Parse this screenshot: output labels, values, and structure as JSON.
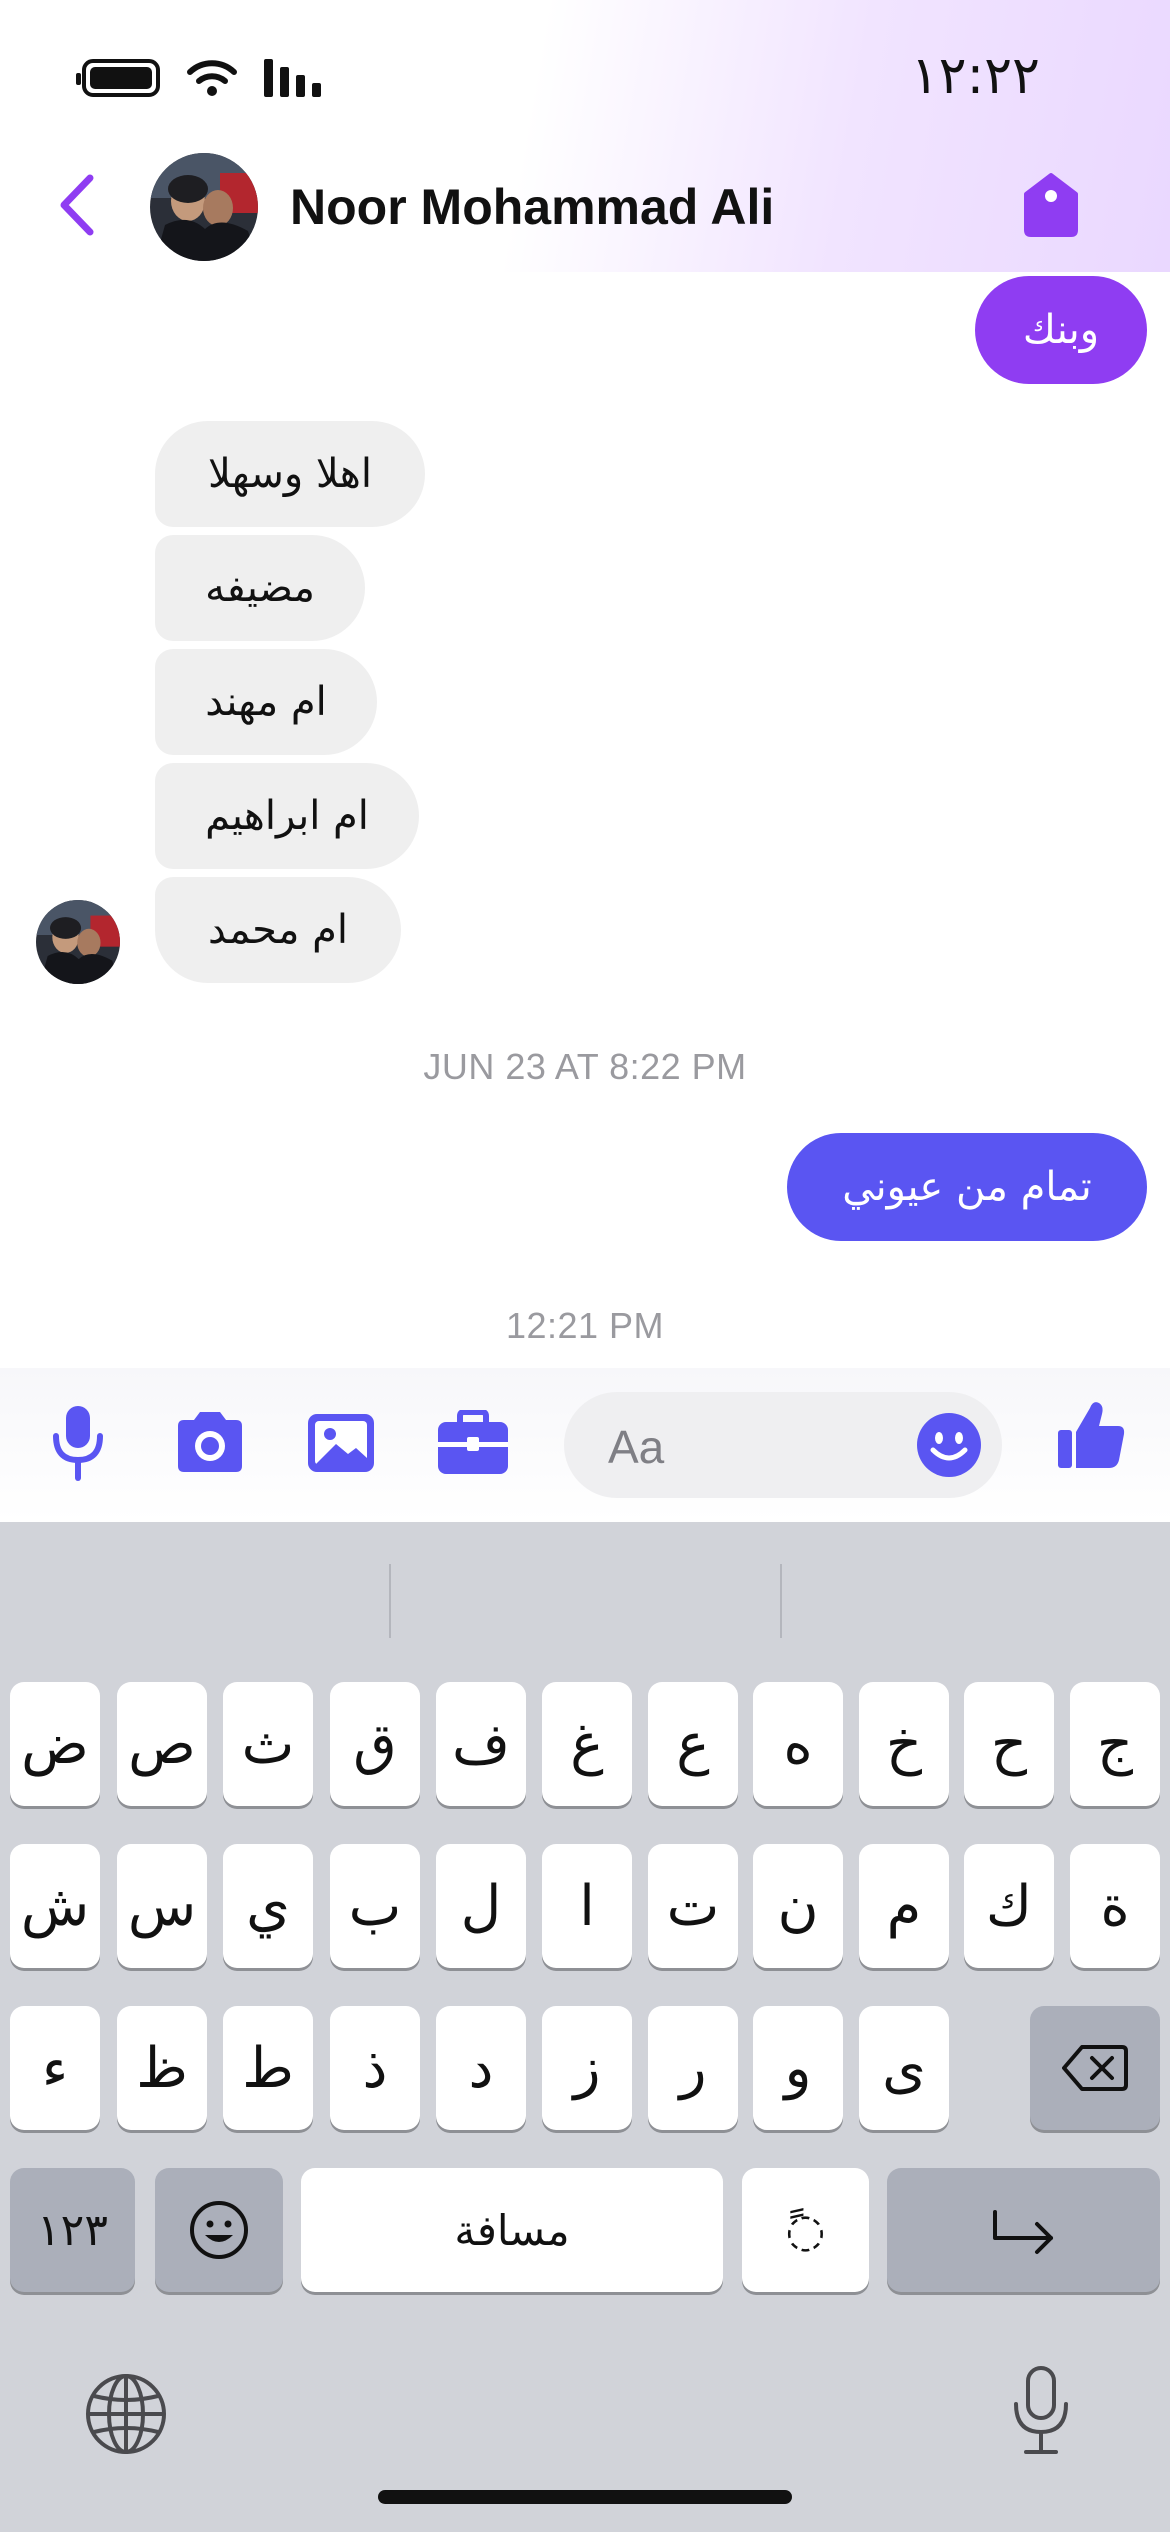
{
  "status_bar": {
    "time": "١٢:٢٢"
  },
  "header": {
    "back_icon": "chevron-left-icon",
    "contact_name": "Noor Mohammad Ali",
    "tag_icon": "tag-icon",
    "accent_color": "#8f3df2"
  },
  "messages": {
    "outgoing_top": "وبنك",
    "incoming": [
      "اهلا وسهلا",
      "مضيفه",
      "ام مهند",
      "ام ابراهيم",
      "ام محمد"
    ],
    "timestamp_1": "JUN 23 AT 8:22 PM",
    "outgoing_2": "تمام من عيوني",
    "timestamp_2": "12:21 PM"
  },
  "composer": {
    "placeholder": "Aa",
    "icons": [
      "microphone-icon",
      "camera-icon",
      "image-icon",
      "briefcase-icon",
      "emoji-icon",
      "thumbs-up-icon"
    ],
    "accent_color": "#5a55f2"
  },
  "keyboard": {
    "row1": [
      "ج",
      "ح",
      "خ",
      "ه",
      "ع",
      "غ",
      "ف",
      "ق",
      "ث",
      "ص",
      "ض"
    ],
    "row2": [
      "ة",
      "ك",
      "م",
      "ن",
      "ت",
      "ا",
      "ل",
      "ب",
      "ي",
      "س",
      "ش"
    ],
    "row3": [
      "ى",
      "و",
      "ر",
      "ز",
      "د",
      "ذ",
      "ط",
      "ظ",
      "ء"
    ],
    "numbers_key": "١٢٣",
    "space_label": "مسافة",
    "diacritic_key": "ً◌",
    "icons": [
      "backspace-icon",
      "return-icon",
      "emoji-keyboard-icon",
      "globe-icon",
      "dictation-mic-icon"
    ]
  }
}
